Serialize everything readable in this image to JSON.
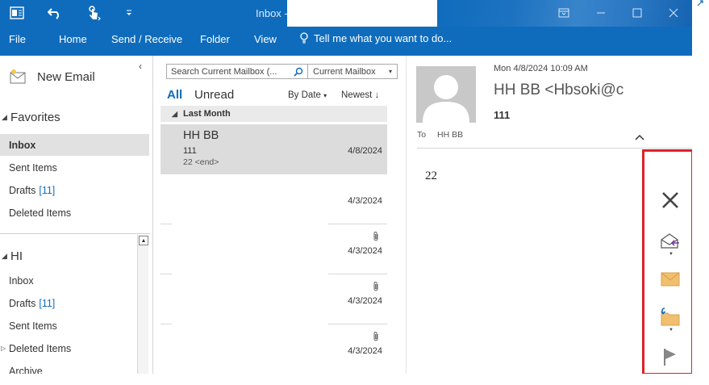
{
  "titlebar": {
    "title": "Inbox -",
    "icons": [
      "outlook-app-icon",
      "undo-icon",
      "touch-mode-icon",
      "customize-qat-icon"
    ],
    "window_buttons": [
      "ribbon-display-icon",
      "minimize-icon",
      "maximize-icon",
      "close-icon"
    ]
  },
  "ribbon": {
    "tabs": [
      "File",
      "Home",
      "Send / Receive",
      "Folder",
      "View"
    ],
    "tell_me": "Tell me what you want to do..."
  },
  "folder_pane": {
    "new_email": "New Email",
    "favorites": {
      "label": "Favorites",
      "items": [
        {
          "label": "Inbox",
          "count": ""
        },
        {
          "label": "Sent Items",
          "count": ""
        },
        {
          "label": "Drafts",
          "count": "[11]"
        },
        {
          "label": "Deleted Items",
          "count": ""
        }
      ]
    },
    "account": {
      "label": "HI",
      "items": [
        {
          "label": "Inbox",
          "count": ""
        },
        {
          "label": "Drafts",
          "count": "[11]"
        },
        {
          "label": "Sent Items",
          "count": ""
        },
        {
          "label": "Deleted Items",
          "count": ""
        },
        {
          "label": "Archive",
          "count": ""
        }
      ]
    }
  },
  "message_list": {
    "search_placeholder": "Search Current Mailbox (...",
    "scope": "Current Mailbox",
    "filter_all": "All",
    "filter_unread": "Unread",
    "sort_by": "By Date",
    "sort_order": "Newest",
    "group_header": "Last Month",
    "messages": [
      {
        "sender": "HH BB",
        "subject": "111",
        "preview": "22 <end>",
        "date": "4/8/2024"
      },
      {
        "sender": "",
        "subject": "",
        "preview": "",
        "date": "4/3/2024"
      },
      {
        "sender": "",
        "subject": "",
        "preview": "",
        "date": "4/3/2024"
      },
      {
        "sender": "",
        "subject": "",
        "preview": "",
        "date": "4/3/2024"
      },
      {
        "sender": "",
        "subject": "",
        "preview": "",
        "date": "4/3/2024"
      }
    ]
  },
  "reading_pane": {
    "datetime": "Mon 4/8/2024 10:09 AM",
    "from": "HH BB <Hbsoki@c",
    "subject": "111",
    "to_label": "To",
    "to": "HH BB",
    "body": "22"
  },
  "action_bar": {
    "actions": [
      "delete-icon",
      "mark-read-unread-icon",
      "unread-envelope-icon",
      "move-to-folder-icon",
      "flag-icon"
    ],
    "highlight_color": "#e0202a"
  },
  "colors": {
    "accent": "#0f6cbd",
    "selection": "#dcdcdc"
  }
}
